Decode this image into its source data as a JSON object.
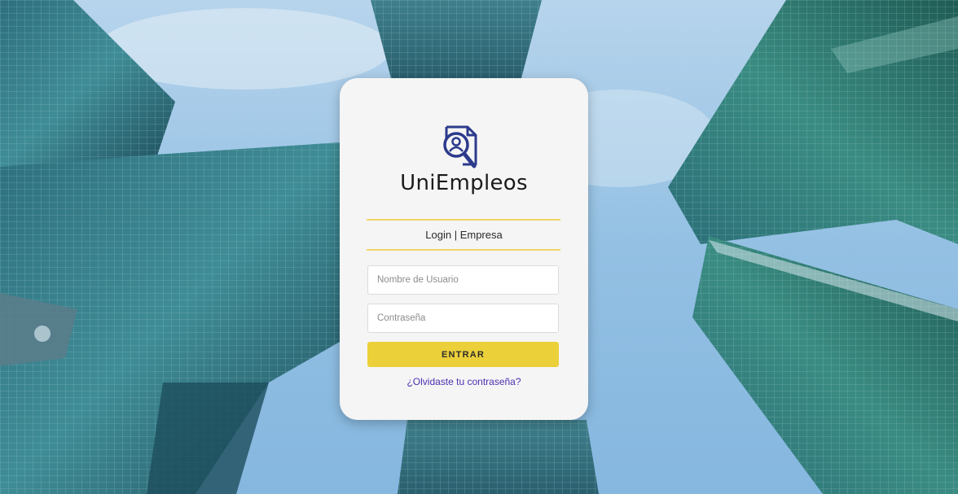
{
  "brand": {
    "name": "UniEmpleos"
  },
  "header": {
    "subtitle": "Login | Empresa"
  },
  "form": {
    "username_placeholder": "Nombre de Usuario",
    "password_placeholder": "Contraseña",
    "submit_label": "ENTRAR",
    "forgot_link": "¿Olvidaste tu contraseña?"
  },
  "icons": {
    "logo": "document-search-user-icon"
  },
  "colors": {
    "accent_yellow": "#ecd03a",
    "rule_yellow": "#f0d566",
    "link_purple": "#4c2fb0",
    "logo_blue": "#2c3a8c",
    "card_bg": "#f5f5f5"
  }
}
